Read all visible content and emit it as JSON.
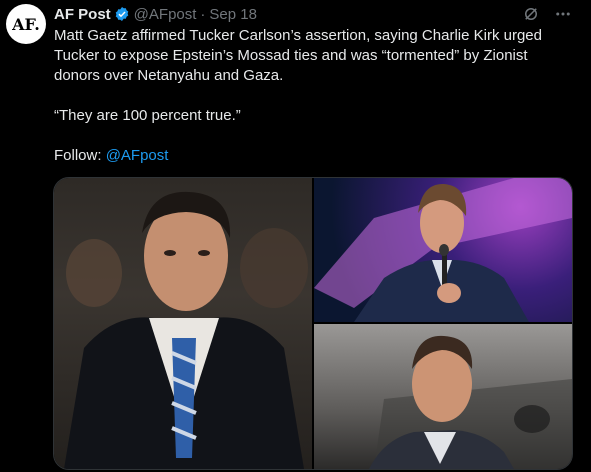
{
  "author": {
    "avatar_text": "AF.",
    "name": "AF Post",
    "handle": "@AFpost",
    "separator": "·",
    "date": "Sep 18"
  },
  "icons": {
    "verified": "verified-badge-icon",
    "grok": "grok-icon",
    "more": "more-icon"
  },
  "post": {
    "text": "Matt Gaetz affirmed Tucker Carlson’s assertion, saying Charlie Kirk urged Tucker to expose Epstein’s Mossad ties and was “tormented” by Zionist donors over Netanyahu and Gaza.",
    "quote": "“They are 100 percent true.”",
    "follow_label": "Follow: ",
    "follow_link": "@AFpost"
  },
  "colors": {
    "background": "#000000",
    "text": "#e7e9ea",
    "muted": "#71767b",
    "link": "#1d9bf0",
    "verified": "#1d9bf0"
  }
}
